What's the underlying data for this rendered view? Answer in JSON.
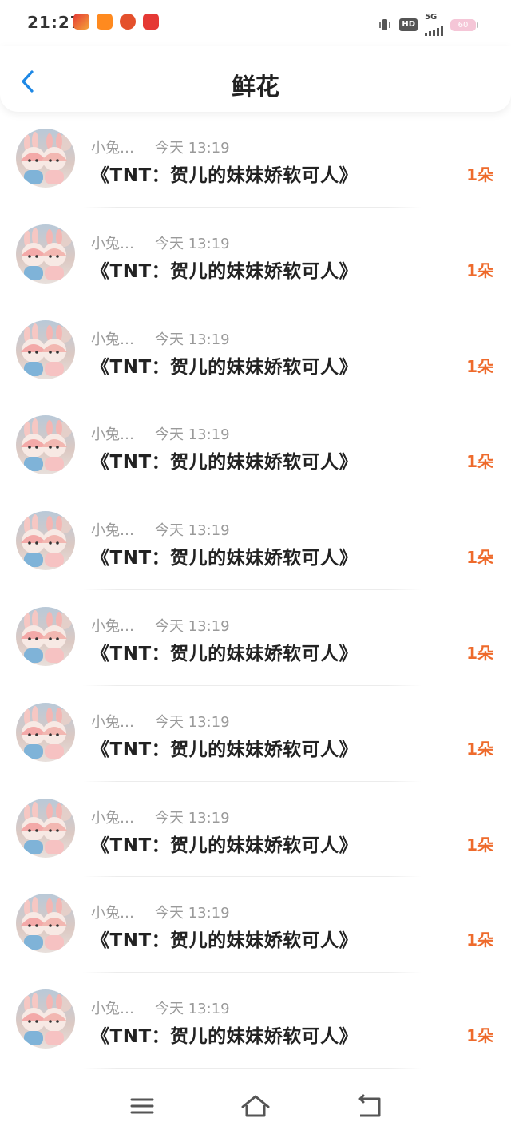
{
  "status_bar": {
    "time": "21:27",
    "network": "5G",
    "hd_label": "HD",
    "battery": "60",
    "app_icons": [
      "red-app-icon",
      "orange-video-app-icon",
      "pumpkin-app-icon",
      "red-play-app-icon"
    ]
  },
  "header": {
    "title": "鲜花",
    "back_icon": "chevron-left-icon",
    "accent_color": "#1e88e5"
  },
  "items": [
    {
      "name": "小兔…",
      "time": "今天 13:19",
      "title": "《TNT：贺儿的妹妹娇软可人》",
      "count": "1朵"
    },
    {
      "name": "小兔…",
      "time": "今天 13:19",
      "title": "《TNT：贺儿的妹妹娇软可人》",
      "count": "1朵"
    },
    {
      "name": "小兔…",
      "time": "今天 13:19",
      "title": "《TNT：贺儿的妹妹娇软可人》",
      "count": "1朵"
    },
    {
      "name": "小兔…",
      "time": "今天 13:19",
      "title": "《TNT：贺儿的妹妹娇软可人》",
      "count": "1朵"
    },
    {
      "name": "小兔…",
      "time": "今天 13:19",
      "title": "《TNT：贺儿的妹妹娇软可人》",
      "count": "1朵"
    },
    {
      "name": "小兔…",
      "time": "今天 13:19",
      "title": "《TNT：贺儿的妹妹娇软可人》",
      "count": "1朵"
    },
    {
      "name": "小兔…",
      "time": "今天 13:19",
      "title": "《TNT：贺儿的妹妹娇软可人》",
      "count": "1朵"
    },
    {
      "name": "小兔…",
      "time": "今天 13:19",
      "title": "《TNT：贺儿的妹妹娇软可人》",
      "count": "1朵"
    },
    {
      "name": "小兔…",
      "time": "今天 13:19",
      "title": "《TNT：贺儿的妹妹娇软可人》",
      "count": "1朵"
    },
    {
      "name": "小兔…",
      "time": "今天 13:19",
      "title": "《TNT：贺儿的妹妹娇软可人》",
      "count": "1朵"
    }
  ],
  "count_color": "#ee6a2b",
  "nav_bar": {
    "icons": [
      "menu-icon",
      "home-icon",
      "back-icon"
    ]
  }
}
